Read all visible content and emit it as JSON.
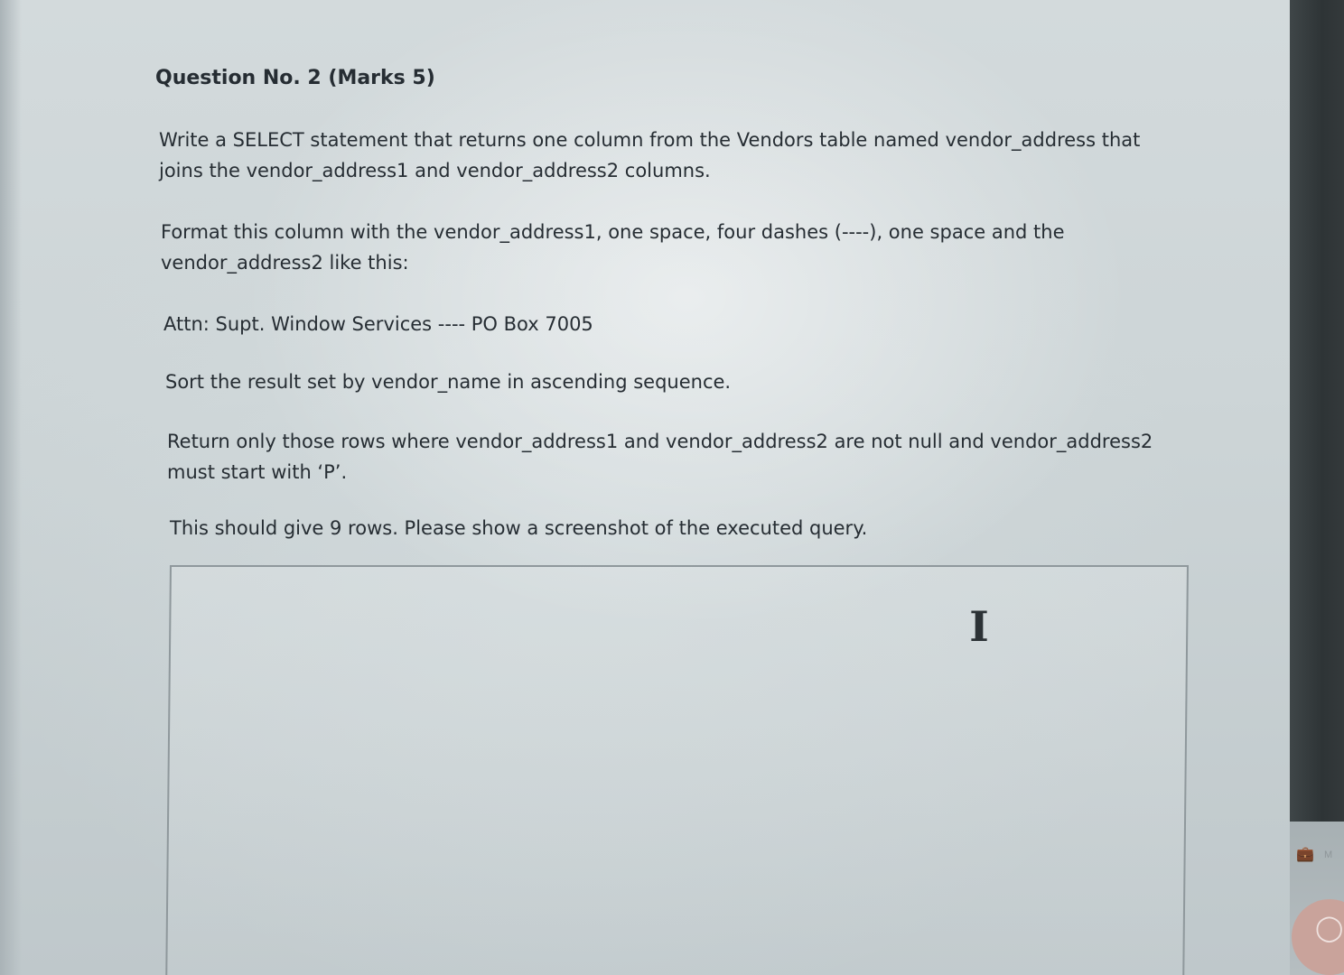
{
  "question": {
    "title": "Question No. 2 (Marks 5)",
    "paragraphs": [
      {
        "lines": [
          "Write a SELECT statement that returns one column from the Vendors table named vendor_address that",
          "joins the vendor_address1 and vendor_address2 columns."
        ]
      },
      {
        "lines": [
          "Format this column with the vendor_address1, one space, four dashes (----), one space and the",
          "vendor_address2 like this:"
        ]
      },
      {
        "lines": [
          "Attn: Supt. Window Services ---- PO Box 7005"
        ]
      },
      {
        "lines": [
          "Sort the result set by vendor_name in ascending sequence."
        ]
      },
      {
        "lines": [
          "Return only those rows where vendor_address1 and vendor_address2 are not null and vendor_address2",
          "must start with ‘P’."
        ]
      },
      {
        "lines": [
          "This should give 9 rows. Please show a screenshot of the executed query."
        ]
      }
    ]
  },
  "answer_box": {
    "cursor_glyph": "I"
  },
  "taskbar": {
    "icon": "briefcase-icon",
    "label": "M"
  },
  "colors": {
    "text": "#262d33",
    "screen_bg": "#cdd5d7",
    "bezel": "#2e3436",
    "avatar": "#c9a39b"
  }
}
